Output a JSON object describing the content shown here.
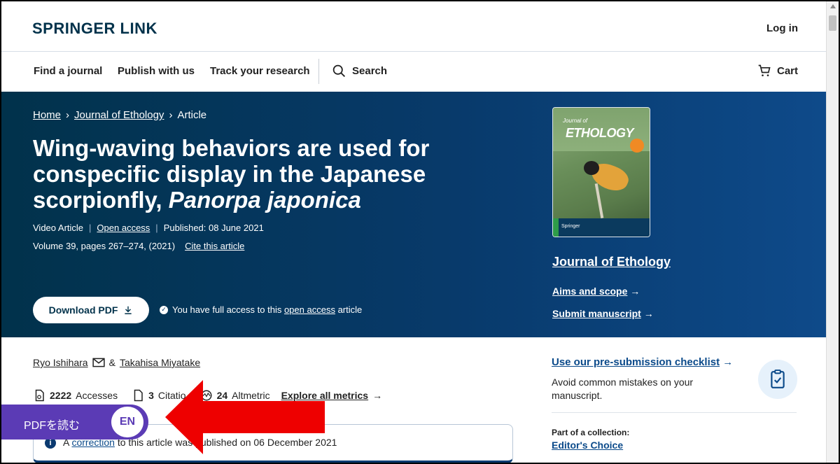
{
  "header": {
    "logo": "SPRINGER LINK",
    "login": "Log in",
    "nav": [
      "Find a journal",
      "Publish with us",
      "Track your research"
    ],
    "search_label": "Search",
    "cart_label": "Cart"
  },
  "hero": {
    "breadcrumb": [
      "Home",
      "Journal of Ethology",
      "Article"
    ],
    "title_main": "Wing-waving behaviors are used for conspecific display in the Japanese scorpionfly, ",
    "title_species": "Panorpa japonica",
    "article_type": "Video Article",
    "open_access": "Open access",
    "published": "Published: 08 June 2021",
    "volume": "Volume 39, pages 267–274, (2021)",
    "cite": "Cite this article",
    "download_pdf": "Download PDF",
    "access_note_prefix": "You have full access to this ",
    "access_note_link": "open access",
    "access_note_suffix": " article"
  },
  "journal_panel": {
    "cover_small_title": "Journal of",
    "cover_name": "ETHOLOGY",
    "cover_publisher": "Springer",
    "journal_name": "Journal of Ethology",
    "aims": "Aims and scope",
    "submit": "Submit manuscript",
    "arrow": "→"
  },
  "article_body": {
    "author1": "Ryo Ishihara",
    "amp": "&",
    "author2": "Takahisa Miyatake",
    "accesses_count": "2222",
    "accesses_label": "Accesses",
    "citations_count": "3",
    "citations_label": "Citatio",
    "altmetric_count": "24",
    "altmetric_label": "Altmetric",
    "explore_metrics": "Explore all metrics",
    "notice_a": "A",
    "notice_link": "correction",
    "notice_rest": "to this article was published on 06 December 2021"
  },
  "sidebar": {
    "checklist": "Use our pre-submission checklist",
    "avoid": "Avoid common mistakes on your manuscript.",
    "part_of": "Part of a collection:",
    "collection": "Editor's Choice"
  },
  "overlay": {
    "pdf_read": "PDFを読む",
    "lang": "EN"
  },
  "colors": {
    "brand_dark": "#01324b",
    "hero_mid": "#083a6b",
    "link_blue": "#0b4a8a",
    "widget_purple": "#5b3bb5",
    "annotation_red": "#ee0000"
  }
}
